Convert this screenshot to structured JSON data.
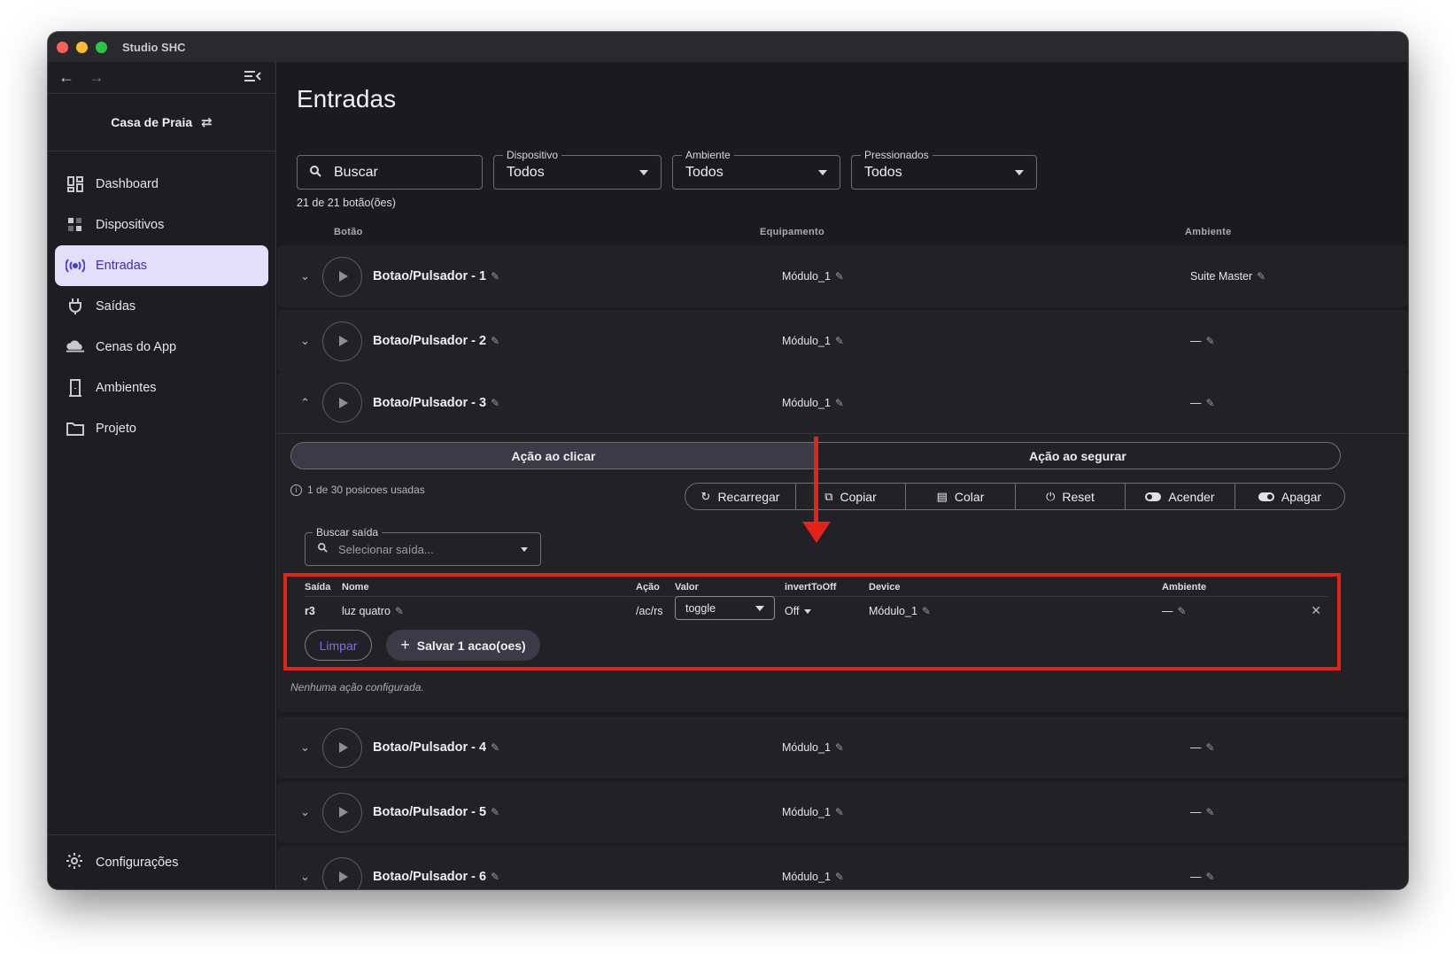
{
  "window": {
    "title": "Studio SHC"
  },
  "sidebar": {
    "house": "Casa de Praia",
    "items": [
      {
        "label": "Dashboard",
        "icon": "dashboard-icon"
      },
      {
        "label": "Dispositivos",
        "icon": "devices-icon"
      },
      {
        "label": "Entradas",
        "icon": "broadcast-icon",
        "active": true
      },
      {
        "label": "Saídas",
        "icon": "plug-icon"
      },
      {
        "label": "Cenas do App",
        "icon": "cloud-icon"
      },
      {
        "label": "Ambientes",
        "icon": "door-icon"
      },
      {
        "label": "Projeto",
        "icon": "folder-icon"
      }
    ],
    "settings": "Configurações"
  },
  "main": {
    "title": "Entradas",
    "search": {
      "placeholder": "Buscar"
    },
    "filters": [
      {
        "label": "Dispositivo",
        "value": "Todos"
      },
      {
        "label": "Ambiente",
        "value": "Todos"
      },
      {
        "label": "Pressionados",
        "value": "Todos"
      }
    ],
    "count": "21 de 21 botão(ões)",
    "columns": {
      "button": "Botão",
      "equipment": "Equipamento",
      "environment": "Ambiente"
    },
    "rows": [
      {
        "name": "Botao/Pulsador - 1",
        "equipment": "Módulo_1",
        "environment": "Suite Master"
      },
      {
        "name": "Botao/Pulsador - 2",
        "equipment": "Módulo_1",
        "environment": "—"
      },
      {
        "name": "Botao/Pulsador - 3",
        "equipment": "Módulo_1",
        "environment": "—"
      },
      {
        "name": "Botao/Pulsador - 4",
        "equipment": "Módulo_1",
        "environment": "—"
      },
      {
        "name": "Botao/Pulsador - 5",
        "equipment": "Módulo_1",
        "environment": "—"
      },
      {
        "name": "Botao/Pulsador - 6",
        "equipment": "Módulo_1",
        "environment": "—"
      }
    ],
    "expanded": {
      "tabs": [
        "Ação ao clicar",
        "Ação ao segurar"
      ],
      "positions_info": "1 de 30 posicoes usadas",
      "actions": [
        "Recarregar",
        "Copiar",
        "Colar",
        "Reset",
        "Acender",
        "Apagar"
      ],
      "output_search": {
        "label": "Buscar saída",
        "placeholder": "Selecionar saída..."
      },
      "table": {
        "headers": {
          "saida": "Saída",
          "nome": "Nome",
          "acao": "Ação",
          "valor": "Valor",
          "invert": "invertToOff",
          "device": "Device",
          "ambiente": "Ambiente"
        },
        "row": {
          "saida": "r3",
          "nome": "luz quatro",
          "acao": "/ac/rs",
          "valor": "toggle",
          "invert": "Off",
          "device": "Módulo_1",
          "ambiente": "—"
        }
      },
      "clear_label": "Limpar",
      "save_label": "Salvar 1 acao(oes)",
      "no_action": "Nenhuma ação configurada."
    }
  },
  "colors": {
    "accent": "#4a3ccf",
    "active_bg": "#e3dffb",
    "highlight": "#e3231a"
  }
}
